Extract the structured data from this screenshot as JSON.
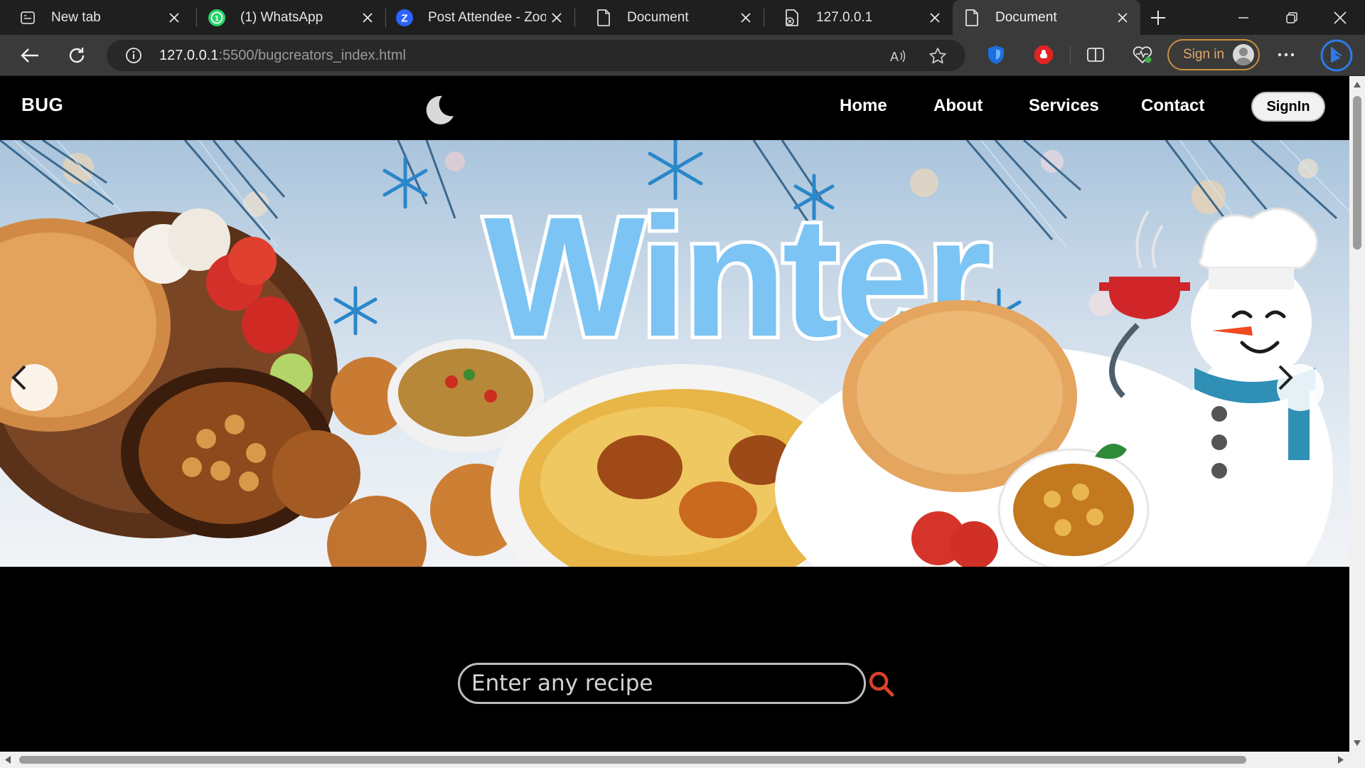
{
  "browser": {
    "tabs": [
      {
        "label": "New tab",
        "icon": "new-tab-page-icon"
      },
      {
        "label": "(1) WhatsApp",
        "icon": "whatsapp-icon"
      },
      {
        "label": "Post Attendee - Zoom",
        "icon": "zoom-icon"
      },
      {
        "label": "Document",
        "icon": "document-icon"
      },
      {
        "label": "127.0.0.1",
        "icon": "document-icon"
      },
      {
        "label": "Document",
        "icon": "document-icon",
        "active": true
      }
    ],
    "url_host": "127.0.0.1",
    "url_path": ":5500/bugcreators_index.html",
    "signin_label": "Sign in"
  },
  "site": {
    "brand": "BUG",
    "nav": {
      "home": "Home",
      "about": "About",
      "services": "Services",
      "contact": "Contact"
    },
    "signin_button": "SignIn",
    "hero": {
      "headline": "Winter"
    },
    "search": {
      "placeholder": "Enter any recipe"
    }
  },
  "colors": {
    "page_background": "#000000",
    "headline_blue": "#7cc4f4",
    "search_icon": "#d9412a",
    "signin_pill_border": "#c9903e"
  }
}
